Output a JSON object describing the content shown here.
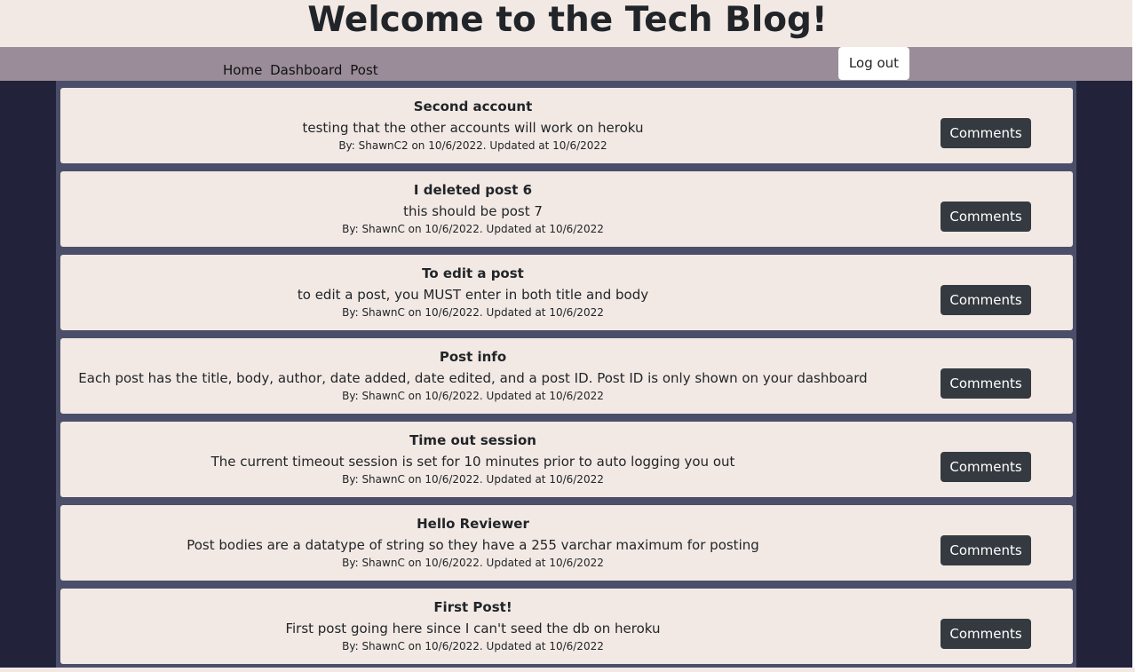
{
  "header": {
    "title": "Welcome to the Tech Blog!"
  },
  "nav": {
    "links": [
      "Home",
      "Dashboard",
      "Post"
    ],
    "logout_label": "Log out"
  },
  "comments_label": "Comments",
  "posts": [
    {
      "title": "Second account",
      "body": "testing that the other accounts will work on heroku",
      "meta": "By: ShawnC2 on 10/6/2022. Updated at 10/6/2022"
    },
    {
      "title": "I deleted post 6",
      "body": "this should be post 7",
      "meta": "By: ShawnC on 10/6/2022. Updated at 10/6/2022"
    },
    {
      "title": "To edit a post",
      "body": "to edit a post, you MUST enter in both title and body",
      "meta": "By: ShawnC on 10/6/2022. Updated at 10/6/2022"
    },
    {
      "title": "Post info",
      "body": "Each post has the title, body, author, date added, date edited, and a post ID. Post ID is only shown on your dashboard",
      "meta": "By: ShawnC on 10/6/2022. Updated at 10/6/2022"
    },
    {
      "title": "Time out session",
      "body": "The current timeout session is set for 10 minutes prior to auto logging you out",
      "meta": "By: ShawnC on 10/6/2022. Updated at 10/6/2022"
    },
    {
      "title": "Hello Reviewer",
      "body": "Post bodies are a datatype of string so they have a 255 varchar maximum for posting",
      "meta": "By: ShawnC on 10/6/2022. Updated at 10/6/2022"
    },
    {
      "title": "First Post!",
      "body": "First post going here since I can't seed the db on heroku",
      "meta": "By: ShawnC on 10/6/2022. Updated at 10/6/2022"
    }
  ]
}
